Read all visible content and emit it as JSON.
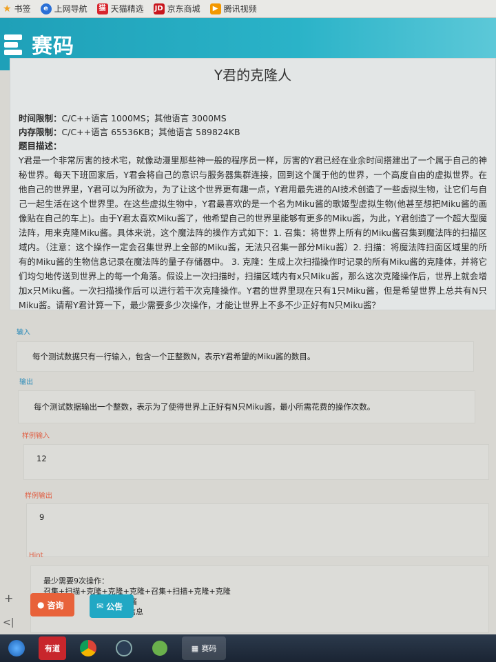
{
  "bookmarks": {
    "items": [
      {
        "label": "书签"
      },
      {
        "label": "上网导航"
      },
      {
        "label": "天猫精选"
      },
      {
        "label": "京东商城"
      },
      {
        "label": "腾讯视频"
      }
    ]
  },
  "header": {
    "brand": "赛码"
  },
  "problem": {
    "title": "Y君的克隆人",
    "time_limit_label": "时间限制：",
    "time_limit_value": "C/C++语言 1000MS；其他语言 3000MS",
    "memory_limit_label": "内存限制：",
    "memory_limit_value": "C/C++语言 65536KB；其他语言 589824KB",
    "desc_label": "题目描述：",
    "description": "Y君是一个非常厉害的技术宅，就像动漫里那些神一般的程序员一样，厉害的Y君已经在业余时间搭建出了一个属于自己的神秘世界。每天下班回家后，Y君会将自己的意识与服务器集群连接，回到这个属于他的世界，一个高度自由的虚拟世界。在他自己的世界里，Y君可以为所欲为，为了让这个世界更有趣一点，Y君用最先进的AI技术创造了一些虚拟生物，让它们与自己一起生活在这个世界里。在这些虚拟生物中，Y君最喜欢的是一个名为Miku酱的歌姬型虚拟生物(他甚至想把Miku酱的画像贴在自己的车上)。由于Y君太喜欢Miku酱了，他希望自己的世界里能够有更多的Miku酱，为此，Y君创造了一个超大型魔法阵，用来克隆Miku酱。具体来说，这个魔法阵的操作方式如下：1. 召集：将世界上所有的Miku酱召集到魔法阵的扫描区域内。（注意：这个操作一定会召集世界上全部的Miku酱，无法只召集一部分Miku酱）2. 扫描：将魔法阵扫面区域里的所有的Miku酱的生物信息记录在魔法阵的量子存储器中。 3. 克隆：生成上次扫描操作时记录的所有Miku酱的克隆体，并将它们均匀地传送到世界上的每一个角落。假设上一次扫描时，扫描区域内有x只Miku酱，那么这次克隆操作后，世界上就会增加x只Miku酱。一次扫描操作后可以进行若干次克隆操作。Y君的世界里现在只有1只Miku酱，但是希望世界上总共有N只Miku酱。请帮Y君计算一下，最少需要多少次操作，才能让世界上不多不少正好有N只Miku酱？"
  },
  "sections": {
    "input_label": "输入",
    "input_text": "每个测试数据只有一行输入，包含一个正整数N，表示Y君希望的Miku酱的数目。",
    "output_label": "输出",
    "output_text": "每个测试数据输出一个整数，表示为了使得世界上正好有N只Miku酱，最小所需花费的操作次数。",
    "sample_input_label": "样例输入",
    "sample_input": "12",
    "sample_output_label": "样例输出",
    "sample_output": "9",
    "hint_label": "Hint",
    "hint_line1": "最少需要9次操作：",
    "hint_line2": "召集+扫描+克隆+克隆+克隆+召集+扫描+克隆+克隆",
    "hint_line3": "召集",
    "hint_line3b": "ku酱",
    "hint_line4": "扫描",
    "hint_line4b": "的信息"
  },
  "floating": {
    "consult_label": "咨询",
    "notice_label": "公告"
  },
  "taskbar": {
    "youdao_label": "有道",
    "active_label": "赛码"
  },
  "colors": {
    "brand": "#1fa0b8",
    "consult": "#e8623a",
    "notice": "#21a8c4",
    "label_blue": "#2b8bb8",
    "label_red": "#e06045"
  }
}
